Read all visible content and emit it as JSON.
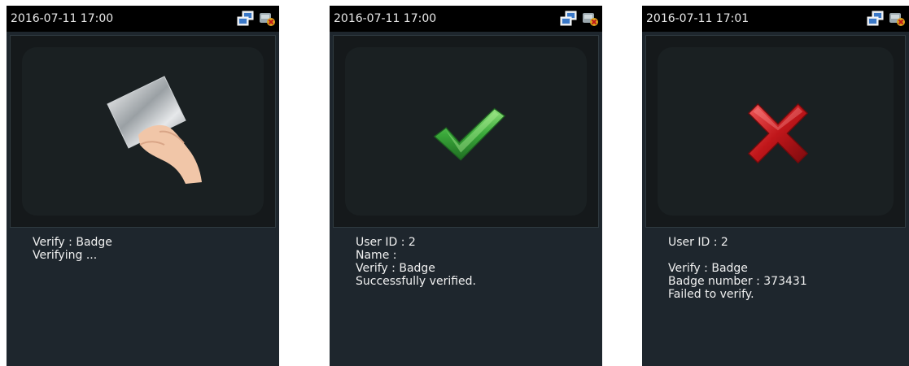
{
  "screens": [
    {
      "timestamp": "2016-07-11 17:00",
      "status_icons": [
        "network-icon",
        "usb-icon"
      ],
      "graphic": "badge-card-icon",
      "lines": [
        "Verify : Badge",
        "Verifying ..."
      ]
    },
    {
      "timestamp": "2016-07-11 17:00",
      "status_icons": [
        "network-icon",
        "usb-icon"
      ],
      "graphic": "check-mark-icon",
      "lines": [
        "User ID : 2",
        "Name :",
        "Verify : Badge",
        "Successfully verified."
      ]
    },
    {
      "timestamp": "2016-07-11 17:01",
      "status_icons": [
        "network-icon",
        "usb-icon"
      ],
      "graphic": "red-x-icon",
      "lines": [
        "User ID : 2",
        "",
        "Verify : Badge",
        "Badge number : 373431",
        "Failed to verify."
      ]
    }
  ],
  "colors": {
    "success": "#3aa83a",
    "failure": "#c0161a",
    "panel": "#1e262d"
  }
}
